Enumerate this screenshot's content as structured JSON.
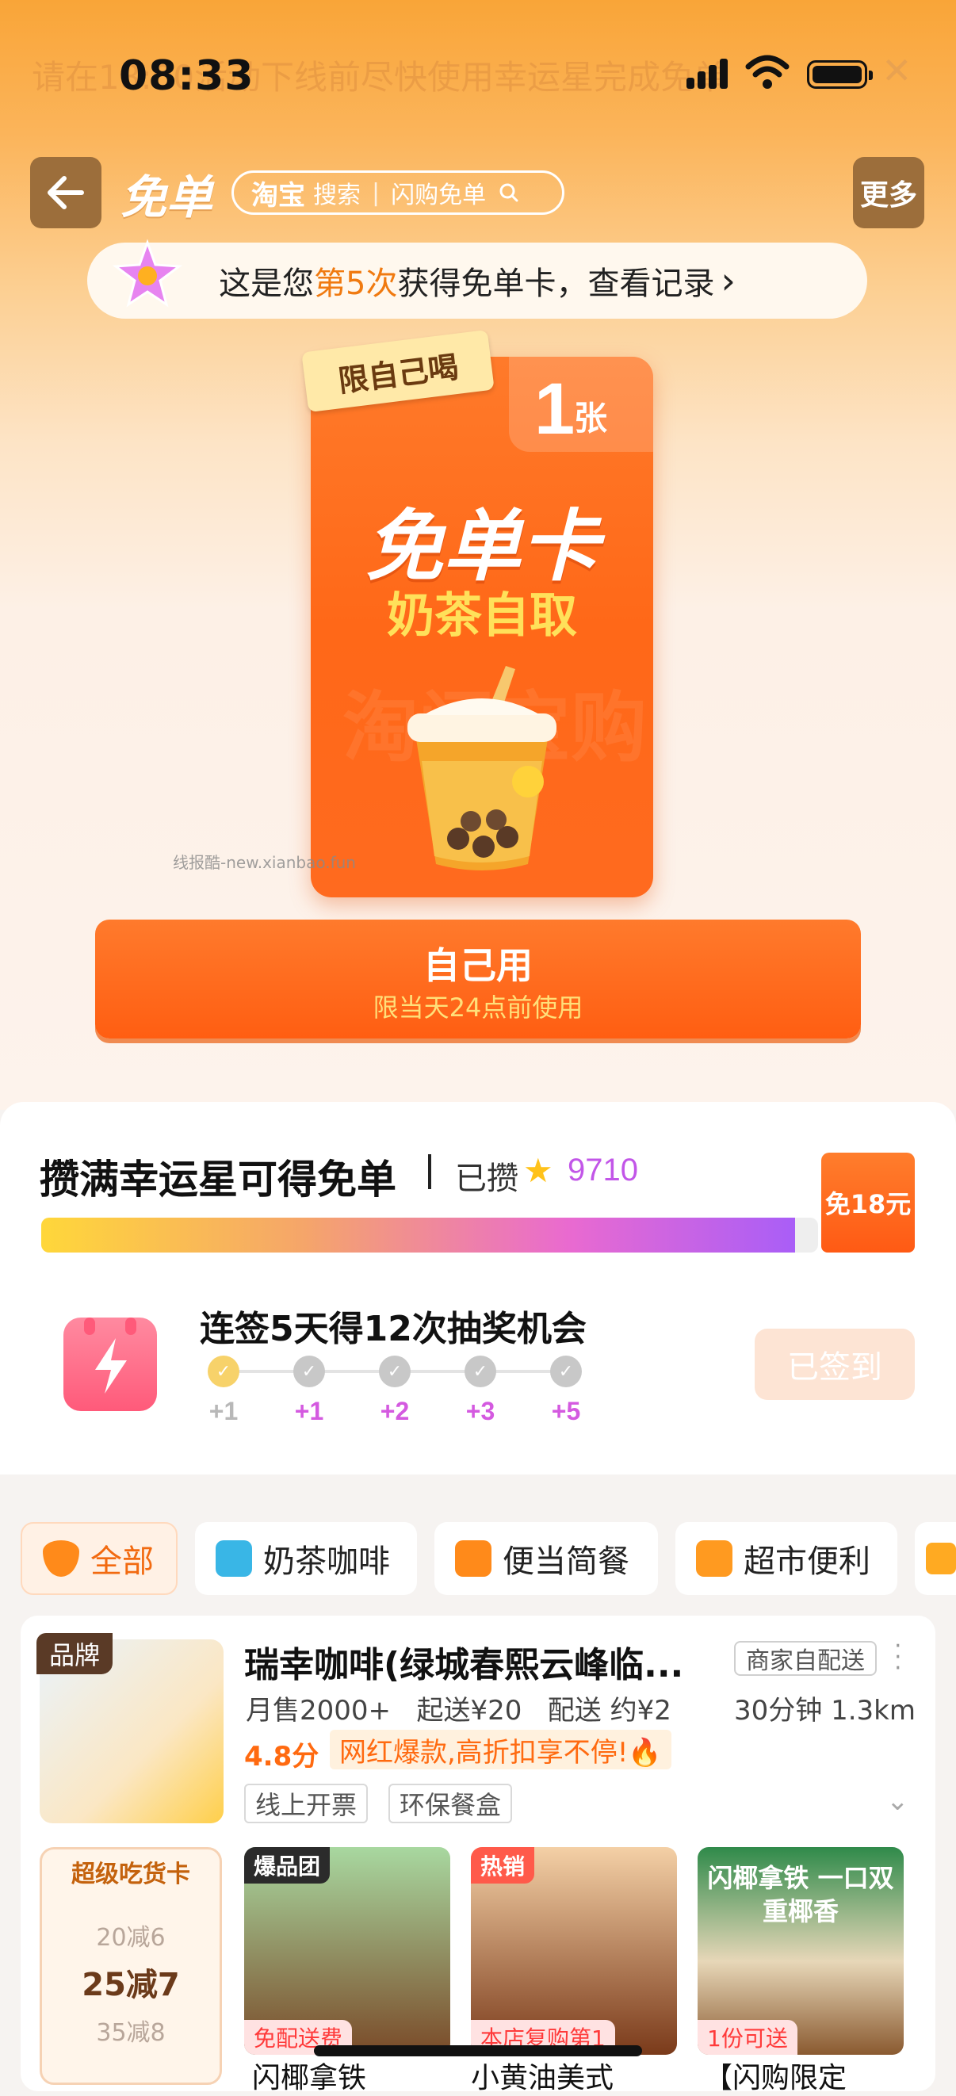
{
  "banner": {
    "text": "请在18:00活动下线前尽快使用幸运星完成免单"
  },
  "status": {
    "time": "08:33"
  },
  "nav": {
    "title": "免单",
    "search_brand": "淘宝",
    "search_word": "搜索",
    "search_hint": "闪购免单",
    "more": "更多"
  },
  "record": {
    "prefix": "这是您",
    "highlight": "第5次",
    "suffix": "获得免单卡，查看记录",
    "chevron": "›"
  },
  "card": {
    "tag": "限自己喝",
    "count": "1",
    "count_unit": "张",
    "title": "免单卡",
    "subtitle": "奶茶自取",
    "bg_text": "淘闪宝购"
  },
  "watermark": "线报酷-new.xianbao.fun",
  "use_button": {
    "label": "自己用",
    "note": "限当天24点前使用"
  },
  "progress": {
    "title": "攒满幸运星可得免单",
    "collected_label": "已攒",
    "stars": "9710",
    "reward": "免18元",
    "fill": 0.97
  },
  "checkin": {
    "title": "连签5天得12次抽奖机会",
    "steps": [
      "+1",
      "+1",
      "+2",
      "+3",
      "+5"
    ],
    "button": "已签到"
  },
  "tabs": [
    {
      "label": "全部",
      "active": true
    },
    {
      "label": "奶茶咖啡",
      "active": false
    },
    {
      "label": "便当简餐",
      "active": false
    },
    {
      "label": "超市便利",
      "active": false
    }
  ],
  "store": {
    "badge": "品牌",
    "name": "瑞幸咖啡(绿城春熙云峰临...",
    "delivery": "商家自配送",
    "monthly": "月售2000+",
    "min_order": "起送¥20",
    "fee": "配送 约¥2",
    "time_dist": "30分钟 1.3km",
    "score": "4.8分",
    "promo": "网红爆款,高折扣享不停!🔥",
    "chips": [
      "线上开票",
      "环保餐盒"
    ]
  },
  "coupon": {
    "head": "超级吃货卡",
    "line1": "20减6",
    "main": "25减7",
    "line3": "35减8"
  },
  "products": [
    {
      "tag": "爆品团",
      "bottom": "免配送费",
      "name": "闪椰拿铁"
    },
    {
      "tag": "热销",
      "bottom": "本店复购第1",
      "name": "小黄油美式"
    },
    {
      "tag": "",
      "bottom": "1份可送",
      "name": "【闪购限定",
      "overlay": "闪椰拿铁 一口双重椰香"
    }
  ],
  "colors": {
    "accent": "#ff6a10",
    "brand_brown": "#9c6e3b",
    "purple": "#c256e8"
  }
}
